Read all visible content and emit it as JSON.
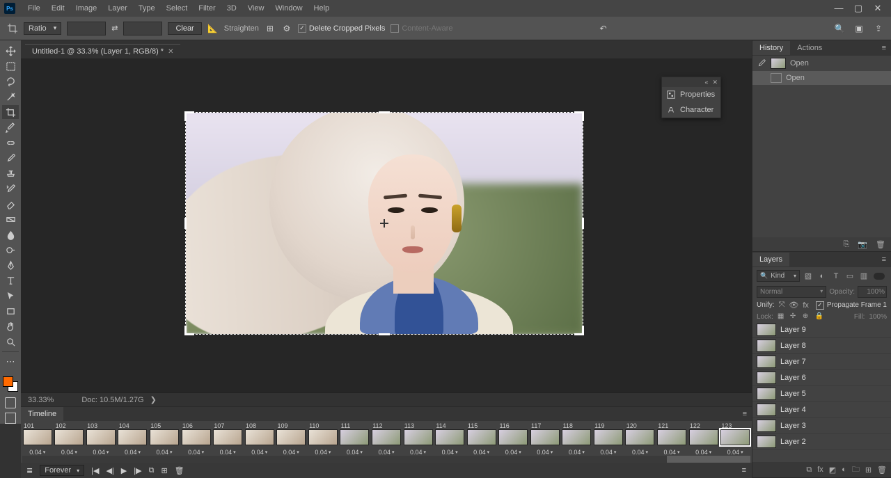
{
  "menu": {
    "items": [
      "File",
      "Edit",
      "Image",
      "Layer",
      "Type",
      "Select",
      "Filter",
      "3D",
      "View",
      "Window",
      "Help"
    ]
  },
  "options": {
    "tool_select": "Ratio",
    "clear": "Clear",
    "straighten": "Straighten",
    "delete_cropped": "Delete Cropped Pixels",
    "content_aware": "Content-Aware"
  },
  "document": {
    "tab": "Untitled-1 @ 33.3% (Layer 1, RGB/8) *"
  },
  "float_panel": {
    "properties": "Properties",
    "character": "Character"
  },
  "history": {
    "tab_history": "History",
    "tab_actions": "Actions",
    "steps": [
      "Open",
      "Open"
    ]
  },
  "layers": {
    "tab": "Layers",
    "kind": "Kind",
    "blend": "Normal",
    "opacity_label": "Opacity:",
    "opacity": "100%",
    "unify": "Unify:",
    "propagate": "Propagate Frame 1",
    "lock": "Lock:",
    "fill_label": "Fill:",
    "fill": "100%",
    "list": [
      "Layer 9",
      "Layer 8",
      "Layer 7",
      "Layer 6",
      "Layer 5",
      "Layer 4",
      "Layer 3",
      "Layer 2"
    ]
  },
  "status": {
    "zoom": "33.33%",
    "doc": "Doc: 10.5M/1.27G"
  },
  "timeline": {
    "tab": "Timeline",
    "loop": "Forever",
    "frames": [
      {
        "n": "101",
        "d": "0.04"
      },
      {
        "n": "102",
        "d": "0.04"
      },
      {
        "n": "103",
        "d": "0.04"
      },
      {
        "n": "104",
        "d": "0.04"
      },
      {
        "n": "105",
        "d": "0.04"
      },
      {
        "n": "106",
        "d": "0.04"
      },
      {
        "n": "107",
        "d": "0.04"
      },
      {
        "n": "108",
        "d": "0.04"
      },
      {
        "n": "109",
        "d": "0.04"
      },
      {
        "n": "110",
        "d": "0.04"
      },
      {
        "n": "111",
        "d": "0.04"
      },
      {
        "n": "112",
        "d": "0.04"
      },
      {
        "n": "113",
        "d": "0.04"
      },
      {
        "n": "114",
        "d": "0.04"
      },
      {
        "n": "115",
        "d": "0.04"
      },
      {
        "n": "116",
        "d": "0.04"
      },
      {
        "n": "117",
        "d": "0.04"
      },
      {
        "n": "118",
        "d": "0.04"
      },
      {
        "n": "119",
        "d": "0.04"
      },
      {
        "n": "120",
        "d": "0.04"
      },
      {
        "n": "121",
        "d": "0.04"
      },
      {
        "n": "122",
        "d": "0.04"
      },
      {
        "n": "123",
        "d": "0.04"
      }
    ],
    "selected_frame": "123"
  }
}
